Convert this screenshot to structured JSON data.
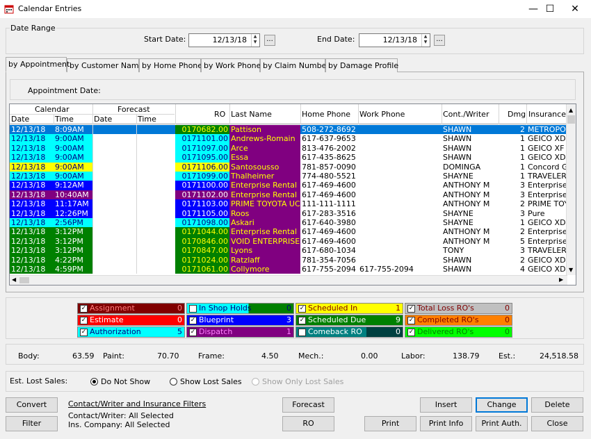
{
  "window": {
    "title": "Calendar Entries",
    "minimize": "—",
    "maximize": "☐",
    "close": "✕"
  },
  "date_range": {
    "legend": "Date Range",
    "start_label": "Start Date:",
    "start_value": "12/13/18",
    "end_label": "End Date:",
    "end_value": "12/13/18",
    "picker": "..."
  },
  "tabs": [
    "by Appointment",
    "by Customer Name",
    "by Home Phone",
    "by Work Phone",
    "by Claim Number",
    "by Damage Profile"
  ],
  "appointment_date_label": "Appointment Date:",
  "grid": {
    "group_headers": {
      "calendar": "Calendar",
      "forecast": "Forecast"
    },
    "columns": {
      "date": "Date",
      "time": "Time",
      "f_date": "Date",
      "f_time": "Time",
      "ro": "RO",
      "last_name": "Last Name",
      "home_phone": "Home Phone",
      "work_phone": "Work Phone",
      "writer": "Cont./Writer",
      "dmg": "Dmg",
      "insurance": "Insurance"
    },
    "rows": [
      {
        "date": "12/13/18",
        "time": "8:09AM",
        "ro": "0170682.00",
        "name": "Pattison",
        "home": "508-272-8692",
        "work": "",
        "writer": "SHAWN",
        "dmg": "2",
        "ins": "METROPO",
        "cal_bg": "#0078d7",
        "cal_fg": "#ffffff",
        "ro_bg": "#008000",
        "ro_fg": "#ffff00",
        "name_bg": "#800080",
        "name_fg": "#ffff00",
        "selected": true
      },
      {
        "date": "12/13/18",
        "time": "9:00AM",
        "ro": "0171101.00",
        "name": "Andrews-Romain",
        "home": "617-637-9653",
        "work": "",
        "writer": "SHAWN",
        "dmg": "1",
        "ins": "GEICO XD",
        "cal_bg": "#00ffff",
        "cal_fg": "#000080",
        "ro_bg": "#00ffff",
        "ro_fg": "#000080",
        "name_bg": "#800080",
        "name_fg": "#ffff00"
      },
      {
        "date": "12/13/18",
        "time": "9:00AM",
        "ro": "0171097.00",
        "name": "Arce",
        "home": "813-476-2002",
        "work": "",
        "writer": "SHAWN",
        "dmg": "1",
        "ins": "GEICO XF",
        "cal_bg": "#00ffff",
        "cal_fg": "#000080",
        "ro_bg": "#00ffff",
        "ro_fg": "#000080",
        "name_bg": "#800080",
        "name_fg": "#ffff00"
      },
      {
        "date": "12/13/18",
        "time": "9:00AM",
        "ro": "0171095.00",
        "name": "Essa",
        "home": "617-435-8625",
        "work": "",
        "writer": "SHAWN",
        "dmg": "1",
        "ins": "GEICO XD",
        "cal_bg": "#00ffff",
        "cal_fg": "#000080",
        "ro_bg": "#00ffff",
        "ro_fg": "#000080",
        "name_bg": "#800080",
        "name_fg": "#ffff00"
      },
      {
        "date": "12/13/18",
        "time": "9:00AM",
        "ro": "0171106.00",
        "name": "Santosousso",
        "home": "781-857-0090",
        "work": "",
        "writer": "DOMINGA",
        "dmg": "1",
        "ins": "Concord G",
        "cal_bg": "#ffff00",
        "cal_fg": "#000080",
        "ro_bg": "#ffff00",
        "ro_fg": "#000080",
        "name_bg": "#800080",
        "name_fg": "#ffff00"
      },
      {
        "date": "12/13/18",
        "time": "9:00AM",
        "ro": "0171099.00",
        "name": "Thalheimer",
        "home": "774-480-5521",
        "work": "",
        "writer": "SHAYNE",
        "dmg": "1",
        "ins": "TRAVELER",
        "cal_bg": "#00ffff",
        "cal_fg": "#000080",
        "ro_bg": "#00ffff",
        "ro_fg": "#000080",
        "name_bg": "#800080",
        "name_fg": "#ffff00"
      },
      {
        "date": "12/13/18",
        "time": "9:12AM",
        "ro": "0171100.00",
        "name": "Enterprise Rental",
        "home": "617-469-4600",
        "work": "",
        "writer": "ANTHONY M",
        "dmg": "3",
        "ins": "Enterprise",
        "cal_bg": "#0000ff",
        "cal_fg": "#ffffff",
        "ro_bg": "#0000ff",
        "ro_fg": "#ffffff",
        "name_bg": "#800080",
        "name_fg": "#ffff00"
      },
      {
        "date": "12/13/18",
        "time": "10:40AM",
        "ro": "0171102.00",
        "name": "Enterprise Rental",
        "home": "617-469-4600",
        "work": "",
        "writer": "ANTHONY M",
        "dmg": "3",
        "ins": "Enterprise",
        "cal_bg": "#800080",
        "cal_fg": "#ffffff",
        "ro_bg": "#800080",
        "ro_fg": "#ffffff",
        "name_bg": "#800080",
        "name_fg": "#ffff00"
      },
      {
        "date": "12/13/18",
        "time": "11:17AM",
        "ro": "0171103.00",
        "name": "PRIME TOYOTA UC",
        "home": "111-111-1111",
        "work": "",
        "writer": "ANTHONY M",
        "dmg": "2",
        "ins": "PRIME TOY",
        "cal_bg": "#0000ff",
        "cal_fg": "#ffffff",
        "ro_bg": "#0000ff",
        "ro_fg": "#ffffff",
        "name_bg": "#800080",
        "name_fg": "#ffff00"
      },
      {
        "date": "12/13/18",
        "time": "12:26PM",
        "ro": "0171105.00",
        "name": "Roos",
        "home": "617-283-3516",
        "work": "",
        "writer": "SHAYNE",
        "dmg": "3",
        "ins": "Pure",
        "cal_bg": "#0000ff",
        "cal_fg": "#ffffff",
        "ro_bg": "#0000ff",
        "ro_fg": "#ffffff",
        "name_bg": "#800080",
        "name_fg": "#ffff00"
      },
      {
        "date": "12/13/18",
        "time": "2:56PM",
        "ro": "0171098.00",
        "name": "Askari",
        "home": "617-640-3980",
        "work": "",
        "writer": "SHAYNE",
        "dmg": "1",
        "ins": "GEICO XD",
        "cal_bg": "#00ffff",
        "cal_fg": "#000080",
        "ro_bg": "#00ffff",
        "ro_fg": "#000080",
        "name_bg": "#800080",
        "name_fg": "#ffff00"
      },
      {
        "date": "12/13/18",
        "time": "3:12PM",
        "ro": "0171044.00",
        "name": "Enterprise Rental",
        "home": "617-469-4600",
        "work": "",
        "writer": "ANTHONY M",
        "dmg": "2",
        "ins": "Enterprise",
        "cal_bg": "#008000",
        "cal_fg": "#ffffff",
        "ro_bg": "#008000",
        "ro_fg": "#ffff00",
        "name_bg": "#800080",
        "name_fg": "#ffff00"
      },
      {
        "date": "12/13/18",
        "time": "3:12PM",
        "ro": "0170846.00",
        "name": "VOID ENTERPRISE",
        "home": "617-469-4600",
        "work": "",
        "writer": "ANTHONY M",
        "dmg": "5",
        "ins": "Enterprise",
        "cal_bg": "#008000",
        "cal_fg": "#ffffff",
        "ro_bg": "#008000",
        "ro_fg": "#ffff00",
        "name_bg": "#800080",
        "name_fg": "#ffff00"
      },
      {
        "date": "12/13/18",
        "time": "3:12PM",
        "ro": "0170847.00",
        "name": "Lyons",
        "home": "617-680-1034",
        "work": "",
        "writer": "TONY",
        "dmg": "3",
        "ins": "TRAVELER",
        "cal_bg": "#008000",
        "cal_fg": "#ffffff",
        "ro_bg": "#008000",
        "ro_fg": "#ffff00",
        "name_bg": "#800080",
        "name_fg": "#ffff00"
      },
      {
        "date": "12/13/18",
        "time": "4:22PM",
        "ro": "0171024.00",
        "name": "Ratzlaff",
        "home": "781-354-7056",
        "work": "",
        "writer": "SHAWN",
        "dmg": "2",
        "ins": "GEICO XD",
        "cal_bg": "#008000",
        "cal_fg": "#ffffff",
        "ro_bg": "#008000",
        "ro_fg": "#ffff00",
        "name_bg": "#800080",
        "name_fg": "#ffff00"
      },
      {
        "date": "12/13/18",
        "time": "4:59PM",
        "ro": "0171061.00",
        "name": "Collymore",
        "home": "617-755-2094",
        "work": "617-755-2094",
        "writer": "SHAWN",
        "dmg": "4",
        "ins": "GEICO XD",
        "cal_bg": "#008000",
        "cal_fg": "#ffffff",
        "ro_bg": "#008000",
        "ro_fg": "#ffff00",
        "name_bg": "#800080",
        "name_fg": "#ffff00"
      }
    ]
  },
  "legend": [
    {
      "label": "Assignment",
      "count": "0",
      "checked": true,
      "bg": "#800000",
      "fg": "#ff8080"
    },
    {
      "label": "Estimate",
      "count": "0",
      "checked": true,
      "bg": "#ff0000",
      "fg": "#ffffff"
    },
    {
      "label": "Authorization",
      "count": "5",
      "checked": true,
      "bg": "#00ffff",
      "fg": "#000080"
    },
    {
      "label": "In Shop Holds",
      "count": "0",
      "checked": false,
      "bg": "#00ffff",
      "fg": "#000080",
      "bg2": "#008000"
    },
    {
      "label": "Blueprint",
      "count": "3",
      "checked": true,
      "bg": "#0000ff",
      "fg": "#ffffff"
    },
    {
      "label": "Dispatch",
      "count": "1",
      "checked": true,
      "bg": "#800080",
      "fg": "#ff80ff"
    },
    {
      "label": "Scheduled In",
      "count": "1",
      "checked": true,
      "bg": "#ffff00",
      "fg": "#800000"
    },
    {
      "label": "Scheduled Due",
      "count": "9",
      "checked": true,
      "bg": "#008000",
      "fg": "#ffffff"
    },
    {
      "label": "Comeback RO",
      "count": "0",
      "checked": false,
      "bg": "#008080",
      "fg": "#ffffff"
    },
    {
      "label": "Total Loss RO's",
      "count": "0",
      "checked": true,
      "bg": "#c0c0c0",
      "fg": "#800000"
    },
    {
      "label": "Completed RO's",
      "count": "0",
      "checked": true,
      "bg": "#ff8000",
      "fg": "#800000"
    },
    {
      "label": "Delivered RO's",
      "count": "0",
      "checked": true,
      "bg": "#00ff00",
      "fg": "#008000"
    }
  ],
  "totals": {
    "body_label": "Body:",
    "body": "63.59",
    "paint_label": "Paint:",
    "paint": "70.70",
    "frame_label": "Frame:",
    "frame": "4.50",
    "mech_label": "Mech.:",
    "mech": "0.00",
    "labor_label": "Labor:",
    "labor": "138.79",
    "est_label": "Est.:",
    "est": "24,518.58"
  },
  "lost_sales": {
    "label": "Est. Lost Sales:",
    "opt1": "Do Not Show",
    "opt2": "Show Lost Sales",
    "opt3": "Show Only Lost Sales"
  },
  "filters": {
    "title": "Contact/Writer and Insurance Filters",
    "writer": "Contact/Writer: All Selected",
    "insurance": "Ins. Company:  All Selected"
  },
  "buttons": {
    "convert": "Convert",
    "filter": "Filter",
    "forecast": "Forecast",
    "ro": "RO",
    "insert": "Insert",
    "change": "Change",
    "delete": "Delete",
    "print": "Print",
    "print_info": "Print Info",
    "print_auth": "Print Auth.",
    "close": "Close"
  }
}
